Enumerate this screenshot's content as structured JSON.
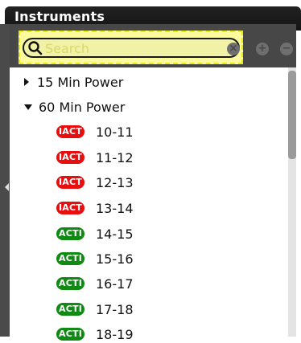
{
  "panel": {
    "title": "Instruments"
  },
  "search": {
    "placeholder": "Search",
    "value": ""
  },
  "toolbar": {
    "clear_icon": "clear-icon",
    "add_icon": "plus-icon",
    "remove_icon": "minus-icon"
  },
  "tree": {
    "groups": [
      {
        "label": "15 Min Power",
        "expanded": false
      },
      {
        "label": "60 Min Power",
        "expanded": true
      }
    ],
    "items": [
      {
        "badge": "IACT",
        "label": "10-11",
        "badge_color": "#e60e0e"
      },
      {
        "badge": "IACT",
        "label": "11-12",
        "badge_color": "#e60e0e"
      },
      {
        "badge": "IACT",
        "label": "12-13",
        "badge_color": "#e60e0e"
      },
      {
        "badge": "IACT",
        "label": "13-14",
        "badge_color": "#e60e0e"
      },
      {
        "badge": "ACTI",
        "label": "14-15",
        "badge_color": "#0f8a12"
      },
      {
        "badge": "ACTI",
        "label": "15-16",
        "badge_color": "#0f8a12"
      },
      {
        "badge": "ACTI",
        "label": "16-17",
        "badge_color": "#0f8a12"
      },
      {
        "badge": "ACTI",
        "label": "17-18",
        "badge_color": "#0f8a12"
      },
      {
        "badge": "ACTI",
        "label": "18-19",
        "badge_color": "#0f8a12"
      }
    ]
  }
}
